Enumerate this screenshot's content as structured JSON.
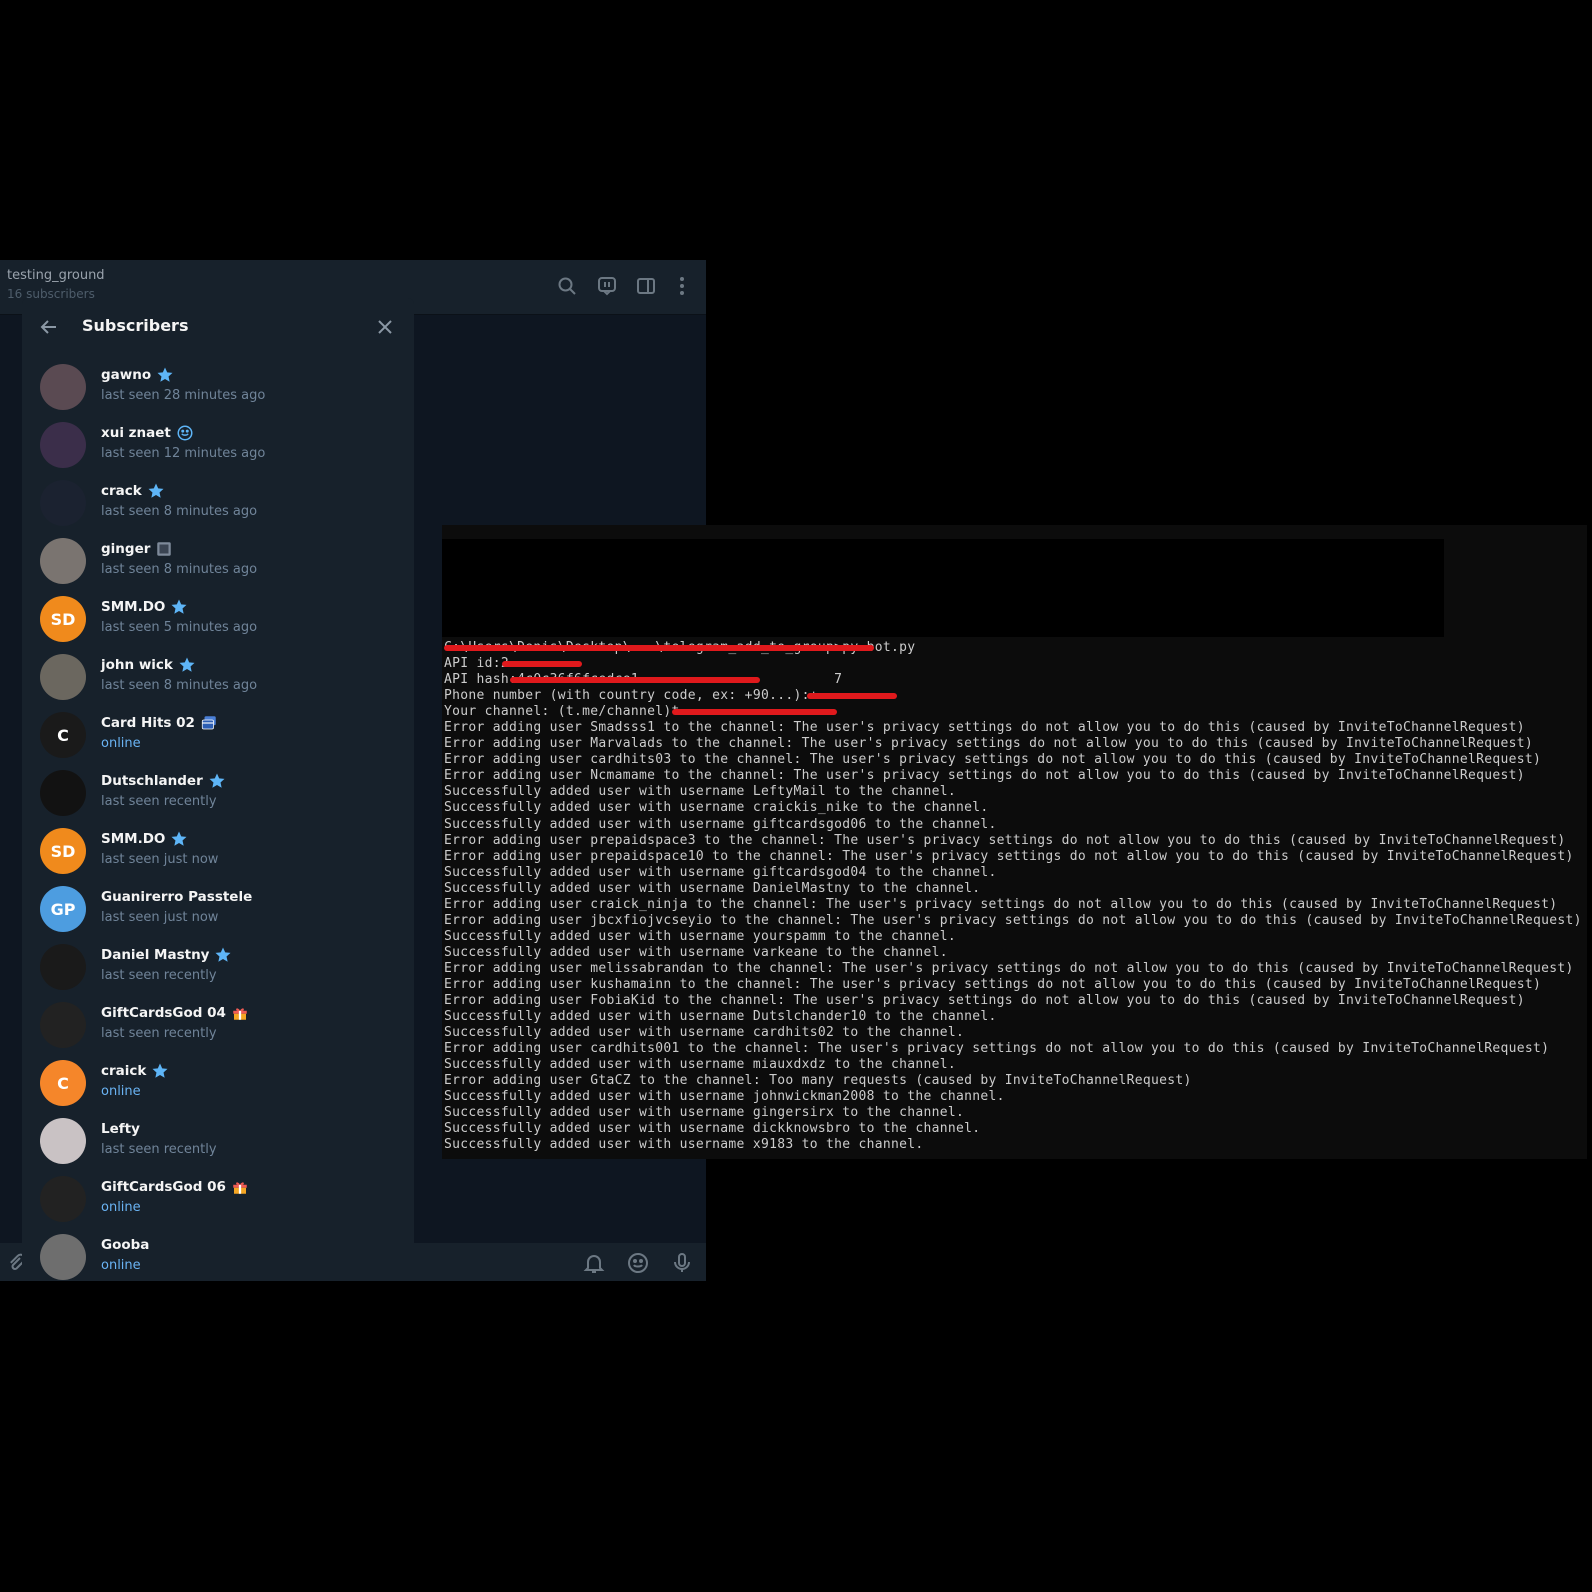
{
  "channel": {
    "title": "testing_ground",
    "subtitle": "16 subscribers"
  },
  "subscribers_panel": {
    "title": "Subscribers",
    "items": [
      {
        "name": "gawno",
        "status": "last seen 28 minutes ago",
        "online": false,
        "badge": "star-icon",
        "avatar_text": "",
        "avatar_color": "#5a4a52"
      },
      {
        "name": "xui znaet",
        "status": "last seen 12 minutes ago",
        "online": false,
        "badge": "smiley-icon",
        "avatar_text": "",
        "avatar_color": "#3b2e4a"
      },
      {
        "name": "crack",
        "status": "last seen 8 minutes ago",
        "online": false,
        "badge": "star-icon",
        "avatar_text": "",
        "avatar_color": "#1b2230"
      },
      {
        "name": "ginger",
        "status": "last seen 8 minutes ago",
        "online": false,
        "badge": "photo-icon",
        "avatar_text": "",
        "avatar_color": "#7a7470"
      },
      {
        "name": "SMM.DO",
        "status": "last seen 5 minutes ago",
        "online": false,
        "badge": "star-icon",
        "avatar_text": "SD",
        "avatar_color": "#f08a1c"
      },
      {
        "name": "john wick",
        "status": "last seen 8 minutes ago",
        "online": false,
        "badge": "star-icon",
        "avatar_text": "",
        "avatar_color": "#6b675f"
      },
      {
        "name": "Card Hits 02",
        "status": "online",
        "online": true,
        "badge": "cards-icon",
        "avatar_text": "C",
        "avatar_color": "#1a1a1a"
      },
      {
        "name": "Dutschlander",
        "status": "last seen recently",
        "online": false,
        "badge": "star-icon",
        "avatar_text": "",
        "avatar_color": "#121212"
      },
      {
        "name": "SMM.DO",
        "status": "last seen just now",
        "online": false,
        "badge": "star-icon",
        "avatar_text": "SD",
        "avatar_color": "#f08a1c"
      },
      {
        "name": "Guanirerro Passtele",
        "status": "last seen just now",
        "online": false,
        "badge": "",
        "avatar_text": "GP",
        "avatar_color": "#4d9de0"
      },
      {
        "name": "Daniel Mastny",
        "status": "last seen recently",
        "online": false,
        "badge": "star-icon",
        "avatar_text": "",
        "avatar_color": "#1a1a1a"
      },
      {
        "name": "GiftCardsGod 04",
        "status": "last seen recently",
        "online": false,
        "badge": "gift-icon",
        "avatar_text": "",
        "avatar_color": "#222222"
      },
      {
        "name": "craick",
        "status": "online",
        "online": true,
        "badge": "star-icon",
        "avatar_text": "C",
        "avatar_color": "#f5862a"
      },
      {
        "name": "Lefty",
        "status": "last seen recently",
        "online": false,
        "badge": "",
        "avatar_text": "",
        "avatar_color": "#c9c2c4"
      },
      {
        "name": "GiftCardsGod 06",
        "status": "online",
        "online": true,
        "badge": "gift-icon",
        "avatar_text": "",
        "avatar_color": "#222222"
      },
      {
        "name": "Gooba",
        "status": "online",
        "online": true,
        "badge": "",
        "avatar_text": "",
        "avatar_color": "#6e6e6e"
      }
    ]
  },
  "terminal": {
    "lines": [
      "C:\\Users\\Denis\\Desktop\\...\\telegram_add_to_group>py bot.py",
      "API id:2",
      "API hash:4c0c36f6fcedce1 ...                    7",
      "Phone number (with country code, ex: +90...):+",
      "Your channel: (t.me/channel)t",
      "Error adding user Smadsss1 to the channel: The user's privacy settings do not allow you to do this (caused by InviteToChannelRequest)",
      "Error adding user Marvalads to the channel: The user's privacy settings do not allow you to do this (caused by InviteToChannelRequest)",
      "Error adding user cardhits03 to the channel: The user's privacy settings do not allow you to do this (caused by InviteToChannelRequest)",
      "Error adding user Ncmamame to the channel: The user's privacy settings do not allow you to do this (caused by InviteToChannelRequest)",
      "Successfully added user with username LeftyMail to the channel.",
      "Successfully added user with username craickis_nike to the channel.",
      "Successfully added user with username giftcardsgod06 to the channel.",
      "Error adding user prepaidspace3 to the channel: The user's privacy settings do not allow you to do this (caused by InviteToChannelRequest)",
      "Error adding user prepaidspace10 to the channel: The user's privacy settings do not allow you to do this (caused by InviteToChannelRequest)",
      "Successfully added user with username giftcardsgod04 to the channel.",
      "Successfully added user with username DanielMastny to the channel.",
      "Error adding user craick_ninja to the channel: The user's privacy settings do not allow you to do this (caused by InviteToChannelRequest)",
      "Error adding user jbcxfiojvcseyio to the channel: The user's privacy settings do not allow you to do this (caused by InviteToChannelRequest)",
      "Successfully added user with username yourspamm to the channel.",
      "Successfully added user with username varkeane to the channel.",
      "Error adding user melissabrandan to the channel: The user's privacy settings do not allow you to do this (caused by InviteToChannelRequest)",
      "Error adding user kushamainn to the channel: The user's privacy settings do not allow you to do this (caused by InviteToChannelRequest)",
      "Error adding user FobiaKid to the channel: The user's privacy settings do not allow you to do this (caused by InviteToChannelRequest)",
      "Successfully added user with username Dutslchander10 to the channel.",
      "Successfully added user with username cardhits02 to the channel.",
      "Error adding user cardhits001 to the channel: The user's privacy settings do not allow you to do this (caused by InviteToChannelRequest)",
      "Successfully added user with username miauxdxdz to the channel.",
      "Error adding user GtaCZ to the channel: Too many requests (caused by InviteToChannelRequest)",
      "Successfully added user with username johnwickman2008 to the channel.",
      "Successfully added user with username gingersirx to the channel.",
      "Successfully added user with username dickknowsbro to the channel.",
      "Successfully added user with username x9183 to the channel."
    ]
  }
}
